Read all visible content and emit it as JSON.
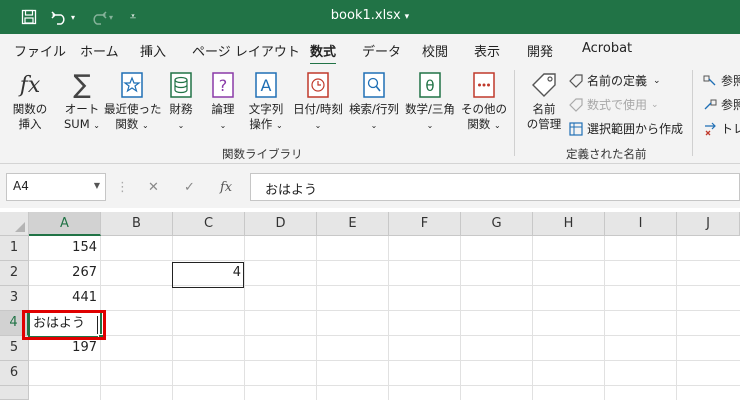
{
  "titlebar": {
    "title": "book1.xlsx",
    "bg_color": "#217346",
    "icons": [
      "save-icon",
      "undo-icon",
      "redo-icon",
      "customize-icon"
    ]
  },
  "tabs": [
    "ファイル",
    "ホーム",
    "挿入",
    "ページ レイアウト",
    "数式",
    "データ",
    "校閲",
    "表示",
    "開発",
    "Acrobat"
  ],
  "active_tab": "数式",
  "ribbon": {
    "function_library": {
      "group_label": "関数ライブラリ",
      "buttons": [
        {
          "line1": "関数の",
          "line2": "挿入",
          "icon": "fx-icon"
        },
        {
          "line1": "オート",
          "line2": "SUM",
          "icon": "sigma-icon"
        },
        {
          "line1": "最近使った",
          "line2": "関数",
          "icon": "star-book-icon"
        },
        {
          "line1": "財務",
          "line2": "",
          "icon": "coins-book-icon"
        },
        {
          "line1": "論理",
          "line2": "",
          "icon": "question-book-icon"
        },
        {
          "line1": "文字列",
          "line2": "操作",
          "icon": "text-book-icon"
        },
        {
          "line1": "日付/時刻",
          "line2": "",
          "icon": "clock-book-icon"
        },
        {
          "line1": "検索/行列",
          "line2": "",
          "icon": "search-book-icon"
        },
        {
          "line1": "数学/三角",
          "line2": "",
          "icon": "theta-book-icon"
        },
        {
          "line1": "その他の",
          "line2": "関数",
          "icon": "more-book-icon"
        }
      ]
    },
    "defined_names": {
      "group_label": "定義された名前",
      "name_manager_line1": "名前",
      "name_manager_line2": "の管理",
      "define_name": "名前の定義",
      "use_in_formula": "数式で使用",
      "create_from_selection": "選択範囲から作成"
    },
    "formula_auditing": {
      "trace_precedents": "参照",
      "trace_dependents": "参照",
      "remove_arrows": "トレ"
    }
  },
  "formula_bar": {
    "name_box": "A4",
    "content": "おはよう",
    "fx_label": "fx"
  },
  "grid": {
    "columns": [
      "A",
      "B",
      "C",
      "D",
      "E",
      "F",
      "G",
      "H",
      "I",
      "J"
    ],
    "rows": [
      "1",
      "2",
      "3",
      "4",
      "5",
      "6"
    ],
    "selected_column": "A",
    "selected_row": "4",
    "cells": {
      "A1": "154",
      "A2": "267",
      "A3": "441",
      "A4": "おはよう",
      "A5": "197",
      "C2": "4"
    },
    "highlight_color": "#e00000"
  }
}
